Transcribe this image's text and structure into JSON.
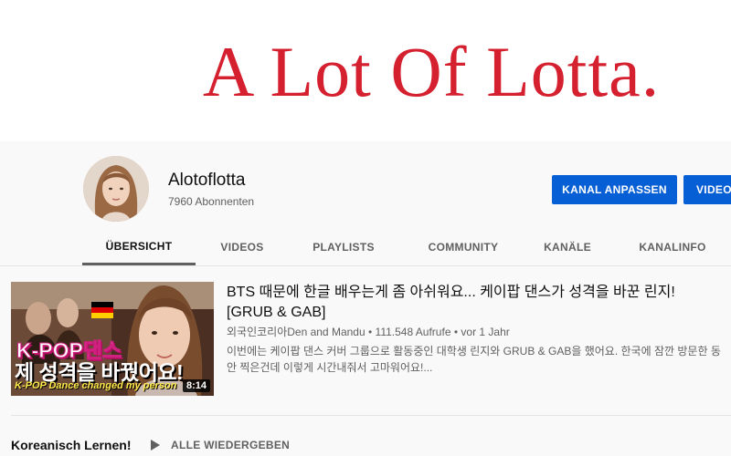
{
  "banner": {
    "title": "A Lot Of Lotta."
  },
  "channel": {
    "name": "Alotoflotta",
    "subscribers": "7960 Abonnenten",
    "customize_button": "KANAL ANPASSEN",
    "videos_button": "VIDEOS"
  },
  "tabs": [
    {
      "label": "ÜBERSICHT",
      "active": true
    },
    {
      "label": "VIDEOS"
    },
    {
      "label": "PLAYLISTS"
    },
    {
      "label": "COMMUNITY"
    },
    {
      "label": "KANÄLE"
    },
    {
      "label": "KANALINFO"
    }
  ],
  "featured_video": {
    "title": "BTS 때문에 한글 배우는게 좀 아쉬워요... 케이팝 댄스가 성격을 바꾼 린지! [GRUB & GAB]",
    "channel": "외국인코리아Den and Mandu",
    "views": "111.548 Aufrufe",
    "age": "vor 1 Jahr",
    "separator": "•",
    "description": "이번에는 케이팝 댄스 커버 그룹으로 활동중인 대학생 린지와 GRUB & GAB을 했어요. 한국에 잠깐 방문한 동안 찍은건데 이렇게 시간내줘서 고마워어요!...",
    "duration": "8:14",
    "thumbnail": {
      "line1": "K-POP댄스",
      "line2": "제 성격을 바꿨어요!",
      "line3": "K-POP Dance changed my person"
    }
  },
  "section": {
    "title": "Koreanisch Lernen!",
    "play_all": "ALLE WIEDERGEBEN"
  },
  "colors": {
    "banner_red": "#d5202f",
    "primary_blue": "#065fd4",
    "header_bg": "#f9f9f9"
  }
}
